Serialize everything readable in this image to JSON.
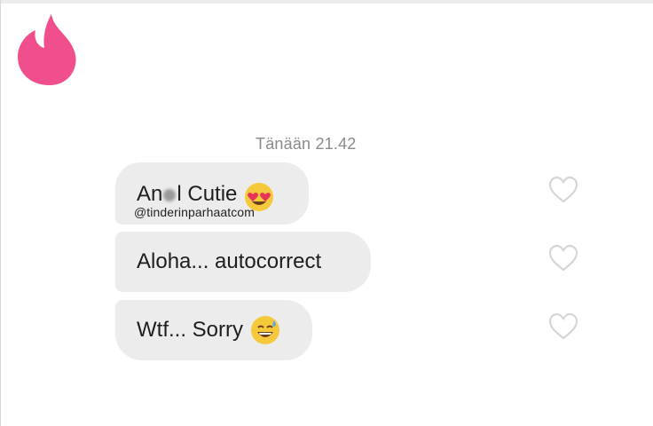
{
  "conversation": {
    "timestamp": "Tänään 21.42",
    "messages": [
      {
        "text_before": "An",
        "text_after": "l Cutie",
        "emoji": "heart-eyes-emoji",
        "liked": false
      },
      {
        "text": "Aloha... autocorrect",
        "liked": false
      },
      {
        "text": "Wtf... Sorry",
        "emoji": "sweat-smile-emoji",
        "liked": false
      }
    ]
  },
  "watermark": "@tinderinparhaatcom",
  "colors": {
    "brand": "#f04e8c",
    "bubble": "#ececec",
    "timestamp": "#8a8a8a",
    "heart_outline": "#d6d6d6"
  }
}
